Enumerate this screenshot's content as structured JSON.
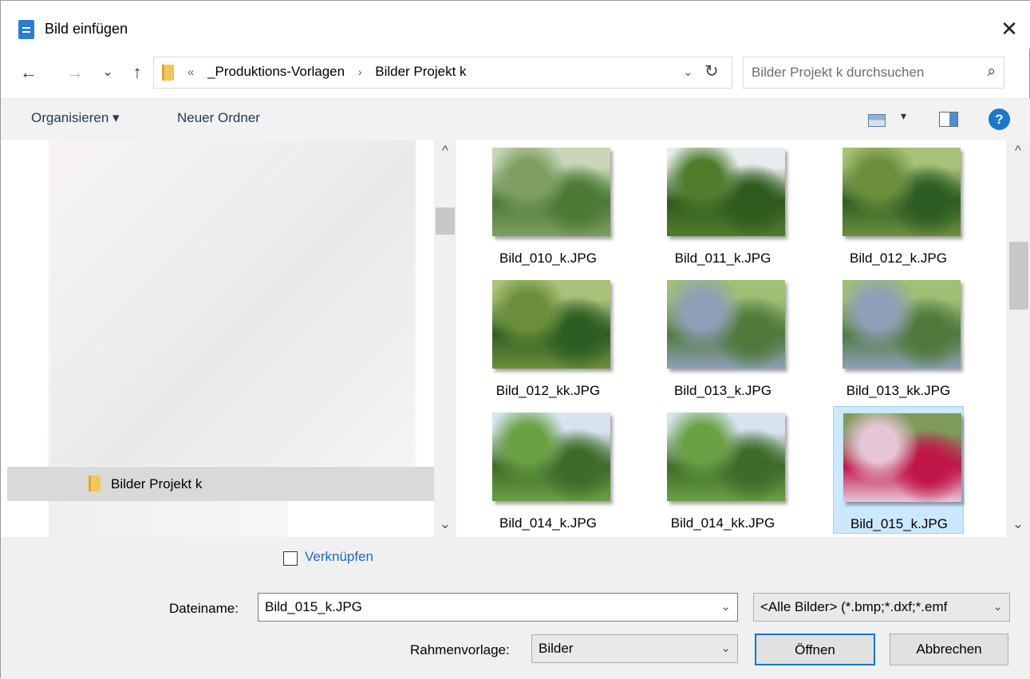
{
  "window": {
    "title": "Bild einfügen",
    "close": "✕"
  },
  "nav": {
    "back": "←",
    "forward": "→",
    "recent": "⌄",
    "up": "↑"
  },
  "address": {
    "overflow": "«",
    "crumb1": "_Produktions-Vorlagen",
    "sep": "›",
    "crumb2": "Bilder Projekt k",
    "dropdown": "⌄",
    "refresh": "↻"
  },
  "search": {
    "placeholder": "Bilder Projekt k durchsuchen",
    "icon": "⌕"
  },
  "toolbar": {
    "organize": "Organisieren ▾",
    "new_folder": "Neuer Ordner",
    "view_drop": "▾",
    "help": "?"
  },
  "tree": {
    "selected_item": "Bilder Projekt k"
  },
  "scroll": {
    "up": "^",
    "down": "⌄"
  },
  "files": [
    {
      "name": "Bild_010_k.JPG",
      "palette": [
        "#c9d6b9",
        "#4b7a35",
        "#7e9e62"
      ]
    },
    {
      "name": "Bild_011_k.JPG",
      "palette": [
        "#e9ecef",
        "#2f5a1d",
        "#4f7d2c"
      ]
    },
    {
      "name": "Bild_012_k.JPG",
      "palette": [
        "#a9c27a",
        "#2e5d23",
        "#6d8f3c"
      ]
    },
    {
      "name": "Bild_012_kk.JPG",
      "palette": [
        "#a9c27a",
        "#2e5d23",
        "#6d8f3c"
      ]
    },
    {
      "name": "Bild_013_k.JPG",
      "palette": [
        "#9fbf74",
        "#4f7a3c",
        "#8f9fb8"
      ]
    },
    {
      "name": "Bild_013_kk.JPG",
      "palette": [
        "#9fbf74",
        "#4f7a3c",
        "#8f9fb8"
      ]
    },
    {
      "name": "Bild_014_k.JPG",
      "palette": [
        "#d7e3ef",
        "#3e6b2a",
        "#6aa043"
      ]
    },
    {
      "name": "Bild_014_kk.JPG",
      "palette": [
        "#d7e3ef",
        "#3e6b2a",
        "#6aa043"
      ]
    },
    {
      "name": "Bild_015_k.JPG",
      "palette": [
        "#7e9b5a",
        "#c0174a",
        "#e7c5d6"
      ]
    }
  ],
  "options": {
    "link_label": "Verknüpfen"
  },
  "filename": {
    "label": "Dateiname:",
    "value": "Bild_015_k.JPG",
    "filter": "<Alle Bilder> (*.bmp;*.dxf;*.emf"
  },
  "frame": {
    "label": "Rahmenvorlage:",
    "value": "Bilder"
  },
  "buttons": {
    "open": "Öffnen",
    "cancel": "Abbrechen"
  }
}
